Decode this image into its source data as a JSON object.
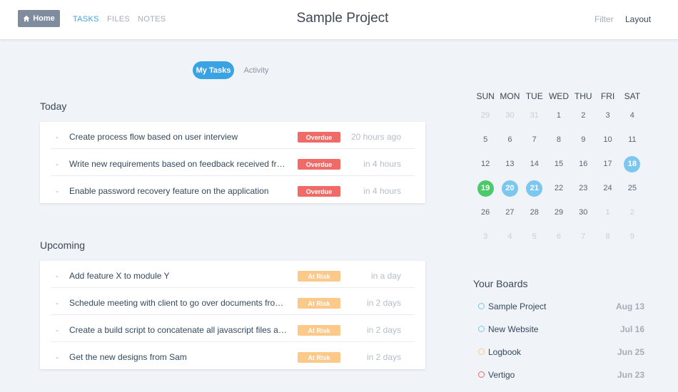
{
  "header": {
    "home_label": "Home",
    "nav": [
      "TASKS",
      "FILES",
      "NOTES"
    ],
    "title": "Sample Project",
    "filter_label": "Filter",
    "layout_label": "Layout",
    "colors": {
      "accent": "#3aa3e3",
      "home_button": "#7f8c9d"
    }
  },
  "view_tabs": [
    "My Tasks",
    "Activity"
  ],
  "today": {
    "title": "Today",
    "tasks": [
      {
        "text": "Create process flow based on user interview",
        "badge": "Overdue",
        "time": "20 hours ago"
      },
      {
        "text": "Write new requirements based on feedback received from client",
        "badge": "Overdue",
        "time": "in 4 hours"
      },
      {
        "text": "Enable password recovery feature on the application",
        "badge": "Overdue",
        "time": "in 4 hours"
      }
    ]
  },
  "upcoming": {
    "title": "Upcoming",
    "tasks": [
      {
        "text": "Add feature X to module Y",
        "badge": "At Risk",
        "time": "in a day"
      },
      {
        "text": "Schedule meeting with client to go over documents from last week",
        "badge": "At Risk",
        "time": "in 2 days"
      },
      {
        "text": "Create a build script to concatenate all javascript files and minify",
        "badge": "At Risk",
        "time": "in 2 days"
      },
      {
        "text": "Get the new designs from Sam",
        "badge": "At Risk",
        "time": "in 2 days"
      }
    ]
  },
  "badge_colors": {
    "Overdue": "#f06b67",
    "At Risk": "#fbc98a"
  },
  "calendar": {
    "weekdays": [
      "SUN",
      "MON",
      "TUE",
      "WED",
      "THU",
      "FRI",
      "SAT"
    ],
    "weeks": [
      [
        "29",
        "30",
        "31",
        "1",
        "2",
        "3",
        "4"
      ],
      [
        "5",
        "6",
        "7",
        "8",
        "9",
        "10",
        "11"
      ],
      [
        "12",
        "13",
        "14",
        "15",
        "16",
        "17",
        "18"
      ],
      [
        "19",
        "20",
        "21",
        "22",
        "23",
        "24",
        "25"
      ],
      [
        "26",
        "27",
        "28",
        "29",
        "30",
        "1",
        "2"
      ],
      [
        "3",
        "4",
        "5",
        "6",
        "7",
        "8",
        "9"
      ]
    ],
    "muted_first_row_prefix": 3,
    "muted_last_rows_from": [
      4,
      5
    ],
    "highlighted": [
      {
        "week": 2,
        "day": 6,
        "style": "blue"
      },
      {
        "week": 3,
        "day": 0,
        "style": "green"
      },
      {
        "week": 3,
        "day": 1,
        "style": "blue"
      },
      {
        "week": 3,
        "day": 2,
        "style": "blue"
      }
    ]
  },
  "boards": {
    "title": "Your Boards",
    "items": [
      {
        "name": "Sample Project",
        "date": "Aug 13",
        "color": "#7cc7ef"
      },
      {
        "name": "New Website",
        "date": "Jul 16",
        "color": "#7cc7ef"
      },
      {
        "name": "Logbook",
        "date": "Jun 25",
        "color": "#fbc98a"
      },
      {
        "name": "Vertigo",
        "date": "Jun 23",
        "color": "#f06b67"
      }
    ]
  }
}
